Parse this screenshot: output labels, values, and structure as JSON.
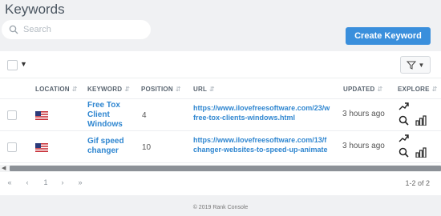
{
  "page": {
    "title": "Keywords"
  },
  "search": {
    "placeholder": "Search",
    "value": ""
  },
  "actions": {
    "create_label": "Create Keyword"
  },
  "columns": {
    "location": "LOCATION",
    "keyword": "KEYWORD",
    "position": "POSITION",
    "url": "URL",
    "updated": "UPDATED",
    "explore": "EXPLORE"
  },
  "rows": [
    {
      "keyword_lines": [
        "Free Tox",
        "Client",
        "Windows"
      ],
      "position": "4",
      "url_lines": [
        "https://www.ilovefreesoftware.com/23/w",
        "free-tox-clients-windows.html"
      ],
      "updated": "3 hours ago",
      "flag": "us-flag"
    },
    {
      "keyword_lines": [
        "Gif speed",
        "changer"
      ],
      "position": "10",
      "url_lines": [
        "https://www.ilovefreesoftware.com/13/f",
        "changer-websites-to-speed-up-animate"
      ],
      "updated": "3 hours ago",
      "flag": "us-flag"
    }
  ],
  "pagination": {
    "first": "«",
    "prev": "‹",
    "page": "1",
    "next": "›",
    "last": "»",
    "info": "1-2 of 2"
  },
  "footer": {
    "text": "© 2019 Rank Console"
  },
  "colors": {
    "accent": "#3a8fdc",
    "link": "#2f86d0",
    "background": "#f0f1f3"
  },
  "icons": [
    "search-icon",
    "chevron-down-icon",
    "filter-icon",
    "sort-icon",
    "us-flag-icon",
    "trend-up-icon",
    "search-icon",
    "bar-chart-icon",
    "scroll-left-icon"
  ]
}
